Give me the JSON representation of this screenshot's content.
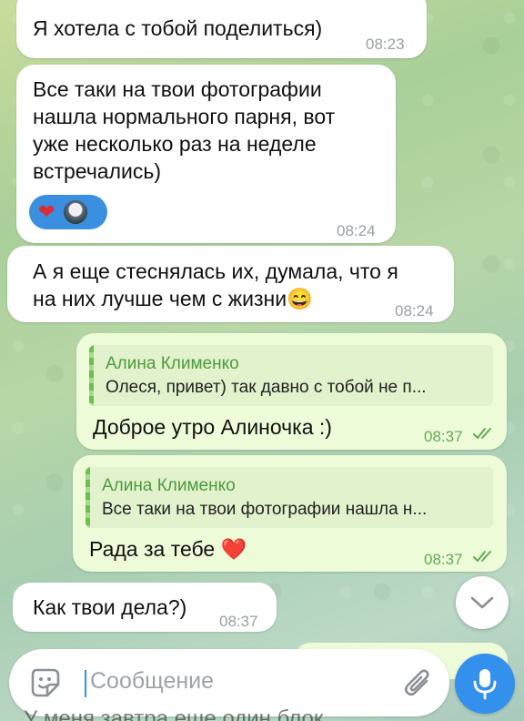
{
  "messages": [
    {
      "text": "Я хотела с тобой поделиться)",
      "time": "08:23"
    },
    {
      "lines": [
        "Все таки на твои фотографии",
        "нашла нормального парня, вот",
        "уже несколько раз на неделе",
        "встречались)"
      ],
      "time": "08:24",
      "reactions": [
        "heart",
        "avatar"
      ]
    },
    {
      "lines": [
        "А я еще стеснялась их, думала, что я",
        "на них лучше чем с жизни"
      ],
      "emoji": "😄",
      "time": "08:24"
    },
    {
      "reply_author": "Алина Клименко",
      "reply_text": "Олеся, привет) так давно с тобой не п...",
      "text": "Доброе утро Алиночка :)",
      "time": "08:37",
      "status": "read"
    },
    {
      "reply_author": "Алина Клименко",
      "reply_text": "Все таки на твои фотографии нашла н...",
      "text": "Рада за тебе",
      "emoji": "❤️",
      "time": "08:37",
      "status": "read"
    },
    {
      "text": "Как твои дела?)",
      "time": "08:37"
    }
  ],
  "composer": {
    "placeholder": "Сообщение"
  },
  "peek_text": "У меня завтра еще один блок",
  "icons": {
    "emoji": "sticker-emoji-icon",
    "attach": "paperclip-icon",
    "mic": "microphone-icon",
    "scroll": "chevron-down-icon",
    "ticks": "double-check-icon"
  },
  "colors": {
    "incoming": "#ffffff",
    "outgoing": "#eefbd9",
    "accent": "#3390ec",
    "outgoing_meta": "#62ac55",
    "reply_author": "#4d9a3e"
  }
}
